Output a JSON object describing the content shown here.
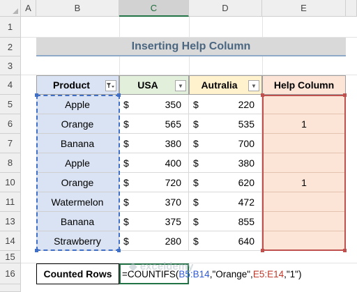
{
  "columns": [
    "A",
    "B",
    "C",
    "D",
    "E"
  ],
  "selected_column": "C",
  "rows": [
    "1",
    "2",
    "3",
    "4",
    "5",
    "6",
    "7",
    "8",
    "10",
    "11",
    "13",
    "14",
    "15",
    "16"
  ],
  "title": "Inserting Help Column",
  "headers": {
    "product": "Product",
    "usa": "USA",
    "australia": "Autralia",
    "help": "Help Column"
  },
  "currency": "$",
  "table_rows": [
    {
      "product": "Apple",
      "usa": "350",
      "australia": "220",
      "help": ""
    },
    {
      "product": "Orange",
      "usa": "565",
      "australia": "535",
      "help": "1"
    },
    {
      "product": "Banana",
      "usa": "380",
      "australia": "700",
      "help": ""
    },
    {
      "product": "Apple",
      "usa": "400",
      "australia": "380",
      "help": ""
    },
    {
      "product": "Orange",
      "usa": "720",
      "australia": "620",
      "help": "1"
    },
    {
      "product": "Watermelon",
      "usa": "370",
      "australia": "472",
      "help": ""
    },
    {
      "product": "Banana",
      "usa": "375",
      "australia": "855",
      "help": ""
    },
    {
      "product": "Strawberry",
      "usa": "280",
      "australia": "640",
      "help": ""
    }
  ],
  "counted_rows": {
    "label": "Counted Rows",
    "formula_parts": [
      "=COUNTIFS(",
      "B5:B14",
      ",\"Orange\",",
      "E5:E14",
      ",\"1\")"
    ]
  },
  "watermark": "exceldemy",
  "colors": {
    "header_blue": "#dae3f3",
    "header_green": "#e2efda",
    "header_yellow": "#fff2cc",
    "header_pink": "#fce4d6",
    "range_blue": "#3f6fc6",
    "range_red": "#c0504d",
    "excel_green": "#217346"
  }
}
